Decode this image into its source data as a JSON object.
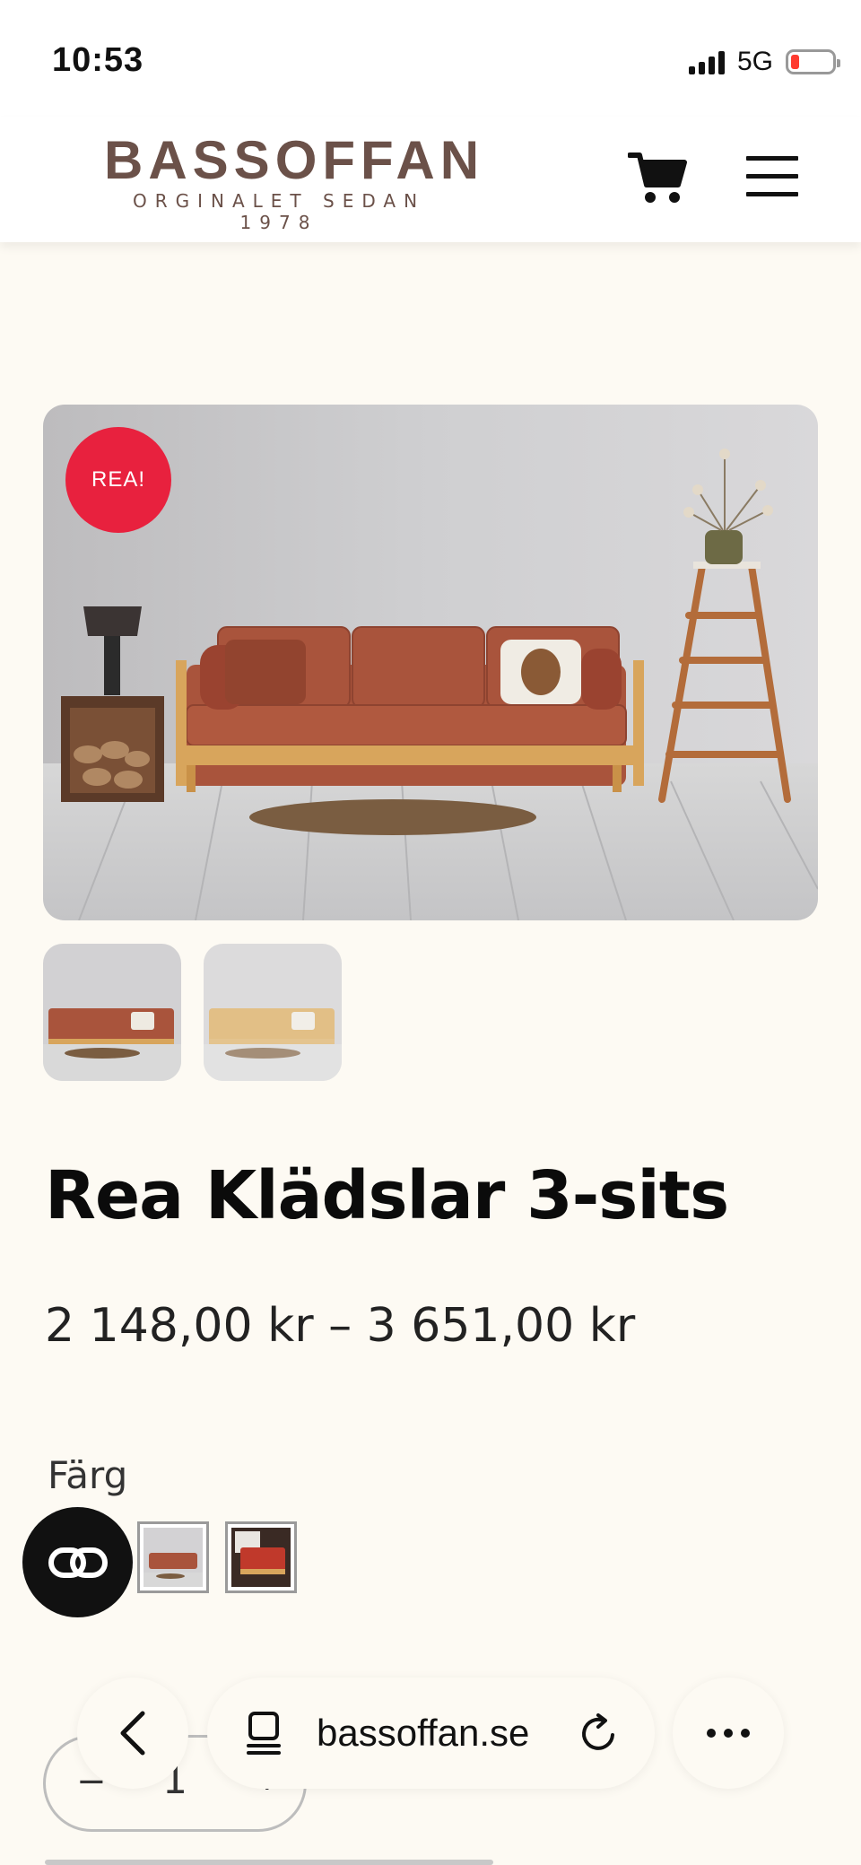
{
  "status_bar": {
    "time": "10:53",
    "network": "5G"
  },
  "header": {
    "logo_title": "BASSOFFAN",
    "logo_subtitle": "ORGINALET SEDAN 1978",
    "icons": [
      "cart-icon",
      "menu-icon"
    ]
  },
  "product": {
    "badge": "REA!",
    "title": "Rea Klädslar 3-sits",
    "price": "2 148,00 kr – 3 651,00 kr",
    "color_label": "Färg",
    "quantity": "1",
    "quantity_minus": "−",
    "quantity_plus": "+"
  },
  "browser": {
    "url": "bassoffan.se",
    "icons": [
      "back-chevron-icon",
      "reader-icon",
      "reload-icon",
      "more-icon"
    ]
  },
  "colors": {
    "background": "#fdfaf3",
    "brand": "#6b5149",
    "sale": "#e8213e",
    "sofa": "#a9543c"
  }
}
